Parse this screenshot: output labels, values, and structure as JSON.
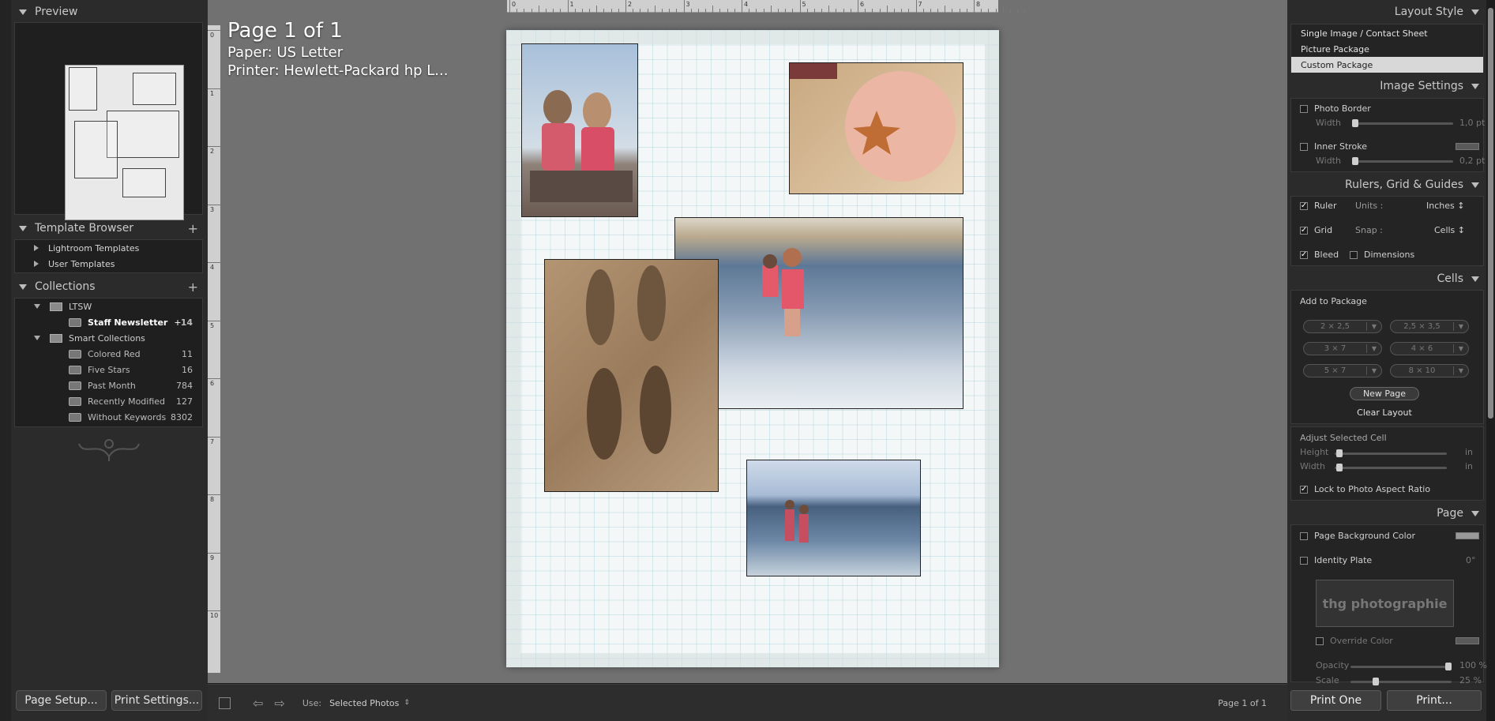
{
  "left": {
    "preview_title": "Preview",
    "template_browser": {
      "title": "Template Browser",
      "items": [
        "Lightroom Templates",
        "User Templates"
      ]
    },
    "collections": {
      "title": "Collections",
      "group1": "LTSW",
      "group1_items": [
        {
          "label": "Staff Newsletter",
          "count": "14"
        }
      ],
      "group2": "Smart Collections",
      "group2_items": [
        {
          "label": "Colored Red",
          "count": "11"
        },
        {
          "label": "Five Stars",
          "count": "16"
        },
        {
          "label": "Past Month",
          "count": "784"
        },
        {
          "label": "Recently Modified",
          "count": "127"
        },
        {
          "label": "Without Keywords",
          "count": "8302"
        }
      ]
    },
    "page_setup": "Page Setup...",
    "print_settings": "Print Settings..."
  },
  "center": {
    "page_title": "Page 1 of 1",
    "paper": "Paper:  US Letter",
    "printer": "Printer:  Hewlett-Packard hp L...",
    "ruler_numbers": [
      "0",
      "1",
      "2",
      "3",
      "4",
      "5",
      "6",
      "7",
      "8"
    ],
    "ruler_v_numbers": [
      "0",
      "1",
      "2",
      "3",
      "4",
      "5",
      "6",
      "7",
      "8",
      "9",
      "10"
    ]
  },
  "toolbar": {
    "use_label": "Use:",
    "use_value": "Selected Photos",
    "page_count": "Page 1 of 1"
  },
  "right": {
    "layout_style": {
      "title": "Layout Style",
      "options": [
        "Single Image / Contact Sheet",
        "Picture Package",
        "Custom Package"
      ],
      "selected": "Custom Package"
    },
    "image_settings": {
      "title": "Image Settings",
      "photo_border": "Photo Border",
      "width": "Width",
      "border_value": "1,0 pt",
      "inner_stroke": "Inner Stroke",
      "stroke_value": "0,2 pt"
    },
    "rulers": {
      "title": "Rulers, Grid & Guides",
      "ruler": "Ruler",
      "units_label": "Units :",
      "units_value": "Inches ↕",
      "grid": "Grid",
      "snap_label": "Snap :",
      "snap_value": "Cells ↕",
      "bleed": "Bleed",
      "dimensions": "Dimensions"
    },
    "cells": {
      "title": "Cells",
      "add_to_package": "Add to Package",
      "sizes": [
        "2 × 2,5",
        "2,5 × 3,5",
        "3 × 7",
        "4 × 6",
        "5 × 7",
        "8 × 10"
      ],
      "new_page": "New Page",
      "clear_layout": "Clear Layout",
      "adjust": "Adjust Selected Cell",
      "height": "Height",
      "width": "Width",
      "unit": "in",
      "lock": "Lock to Photo Aspect Ratio"
    },
    "page": {
      "title": "Page",
      "bg_color": "Page Background Color",
      "identity_plate": "Identity Plate",
      "identity_angle": "0°",
      "plate_text": "thg photographie",
      "override": "Override Color",
      "opacity": "Opacity",
      "opacity_value": "100 %",
      "scale": "Scale",
      "scale_value": "25 %"
    },
    "print_one": "Print One",
    "print": "Print..."
  }
}
